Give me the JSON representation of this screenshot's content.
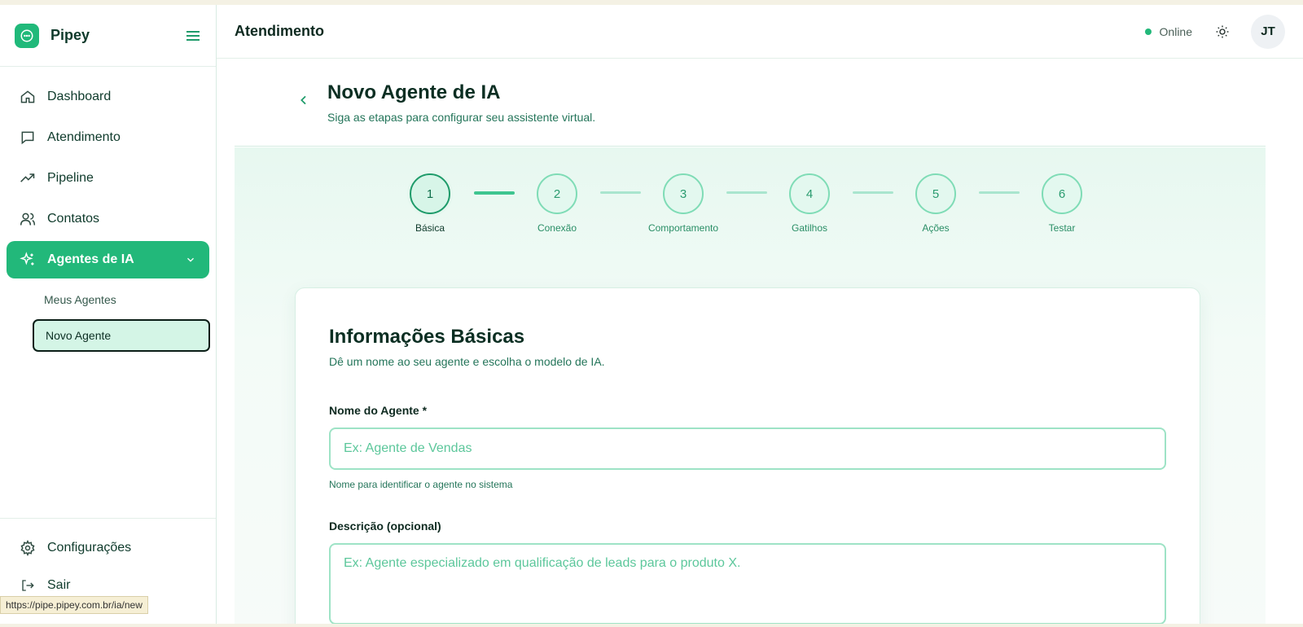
{
  "brand": {
    "name": "Pipey",
    "logo_icon": "chat-bubble-icon",
    "accent": "#22b87a"
  },
  "sidebar": {
    "items": [
      {
        "label": "Dashboard",
        "icon": "home-icon"
      },
      {
        "label": "Atendimento",
        "icon": "message-square-icon"
      },
      {
        "label": "Pipeline",
        "icon": "trending-up-icon"
      },
      {
        "label": "Contatos",
        "icon": "users-icon"
      },
      {
        "label": "Agentes de IA",
        "icon": "sparkles-icon",
        "active": true
      }
    ],
    "subitems": [
      {
        "label": "Meus Agentes"
      },
      {
        "label": "Novo Agente",
        "current": true
      }
    ],
    "bottom": [
      {
        "label": "Configurações",
        "icon": "gear-icon"
      },
      {
        "label": "Sair",
        "icon": "logout-icon"
      }
    ]
  },
  "header": {
    "title": "Atendimento",
    "status_label": "Online",
    "avatar_initials": "JT"
  },
  "page": {
    "title": "Novo Agente de IA",
    "subtitle": "Siga as etapas para configurar seu assistente virtual."
  },
  "stepper": {
    "current": 1,
    "steps": [
      {
        "number": "1",
        "label": "Básica"
      },
      {
        "number": "2",
        "label": "Conexão"
      },
      {
        "number": "3",
        "label": "Comportamento"
      },
      {
        "number": "4",
        "label": "Gatilhos"
      },
      {
        "number": "5",
        "label": "Ações"
      },
      {
        "number": "6",
        "label": "Testar"
      }
    ]
  },
  "form": {
    "title": "Informações Básicas",
    "subtitle": "Dê um nome ao seu agente e escolha o modelo de IA.",
    "name_label": "Nome do Agente *",
    "name_placeholder": "Ex: Agente de Vendas",
    "name_value": "",
    "name_hint": "Nome para identificar o agente no sistema",
    "description_label": "Descrição (opcional)",
    "description_placeholder": "Ex: Agente especializado em qualificação de leads para o produto X.",
    "description_value": ""
  },
  "browser": {
    "status_url": "https://pipe.pipey.com.br/ia/new"
  }
}
